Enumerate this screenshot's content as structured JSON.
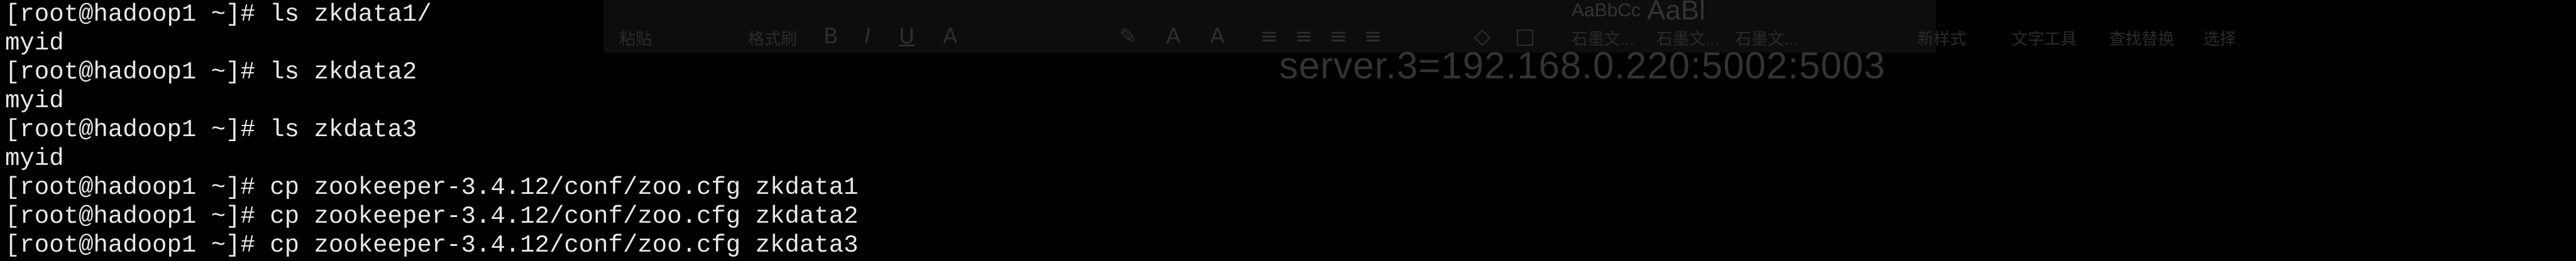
{
  "background": {
    "color": "#000000",
    "ribbon_labels": [
      {
        "text": "粘贴",
        "name": "paste-label"
      },
      {
        "text": "格式刷",
        "name": "format-painter-label"
      }
    ],
    "style_samples": [
      {
        "text": "AaBbCc",
        "name": "style-sample-1"
      },
      {
        "text": "AaBl",
        "name": "style-sample-2"
      }
    ],
    "style_names": [
      "石墨文...",
      "石墨文...",
      "石墨文..."
    ],
    "tool_labels": [
      "新样式",
      "文字工具",
      "查找替换",
      "选择"
    ],
    "document_text": "server.3=192.168.0.220:5002:5003"
  },
  "terminal": {
    "text_color": "#e8e8e8",
    "lines": [
      {
        "prompt": "[root@hadoop1 ~]# ",
        "command": "ls zkdata1/"
      },
      {
        "prompt": "",
        "command": "myid"
      },
      {
        "prompt": "[root@hadoop1 ~]# ",
        "command": "ls zkdata2"
      },
      {
        "prompt": "",
        "command": "myid"
      },
      {
        "prompt": "[root@hadoop1 ~]# ",
        "command": "ls zkdata3"
      },
      {
        "prompt": "",
        "command": "myid"
      },
      {
        "prompt": "[root@hadoop1 ~]# ",
        "command": "cp zookeeper-3.4.12/conf/zoo.cfg zkdata1"
      },
      {
        "prompt": "[root@hadoop1 ~]# ",
        "command": "cp zookeeper-3.4.12/conf/zoo.cfg zkdata2"
      },
      {
        "prompt": "[root@hadoop1 ~]# ",
        "command": "cp zookeeper-3.4.12/conf/zoo.cfg zkdata3"
      }
    ]
  }
}
